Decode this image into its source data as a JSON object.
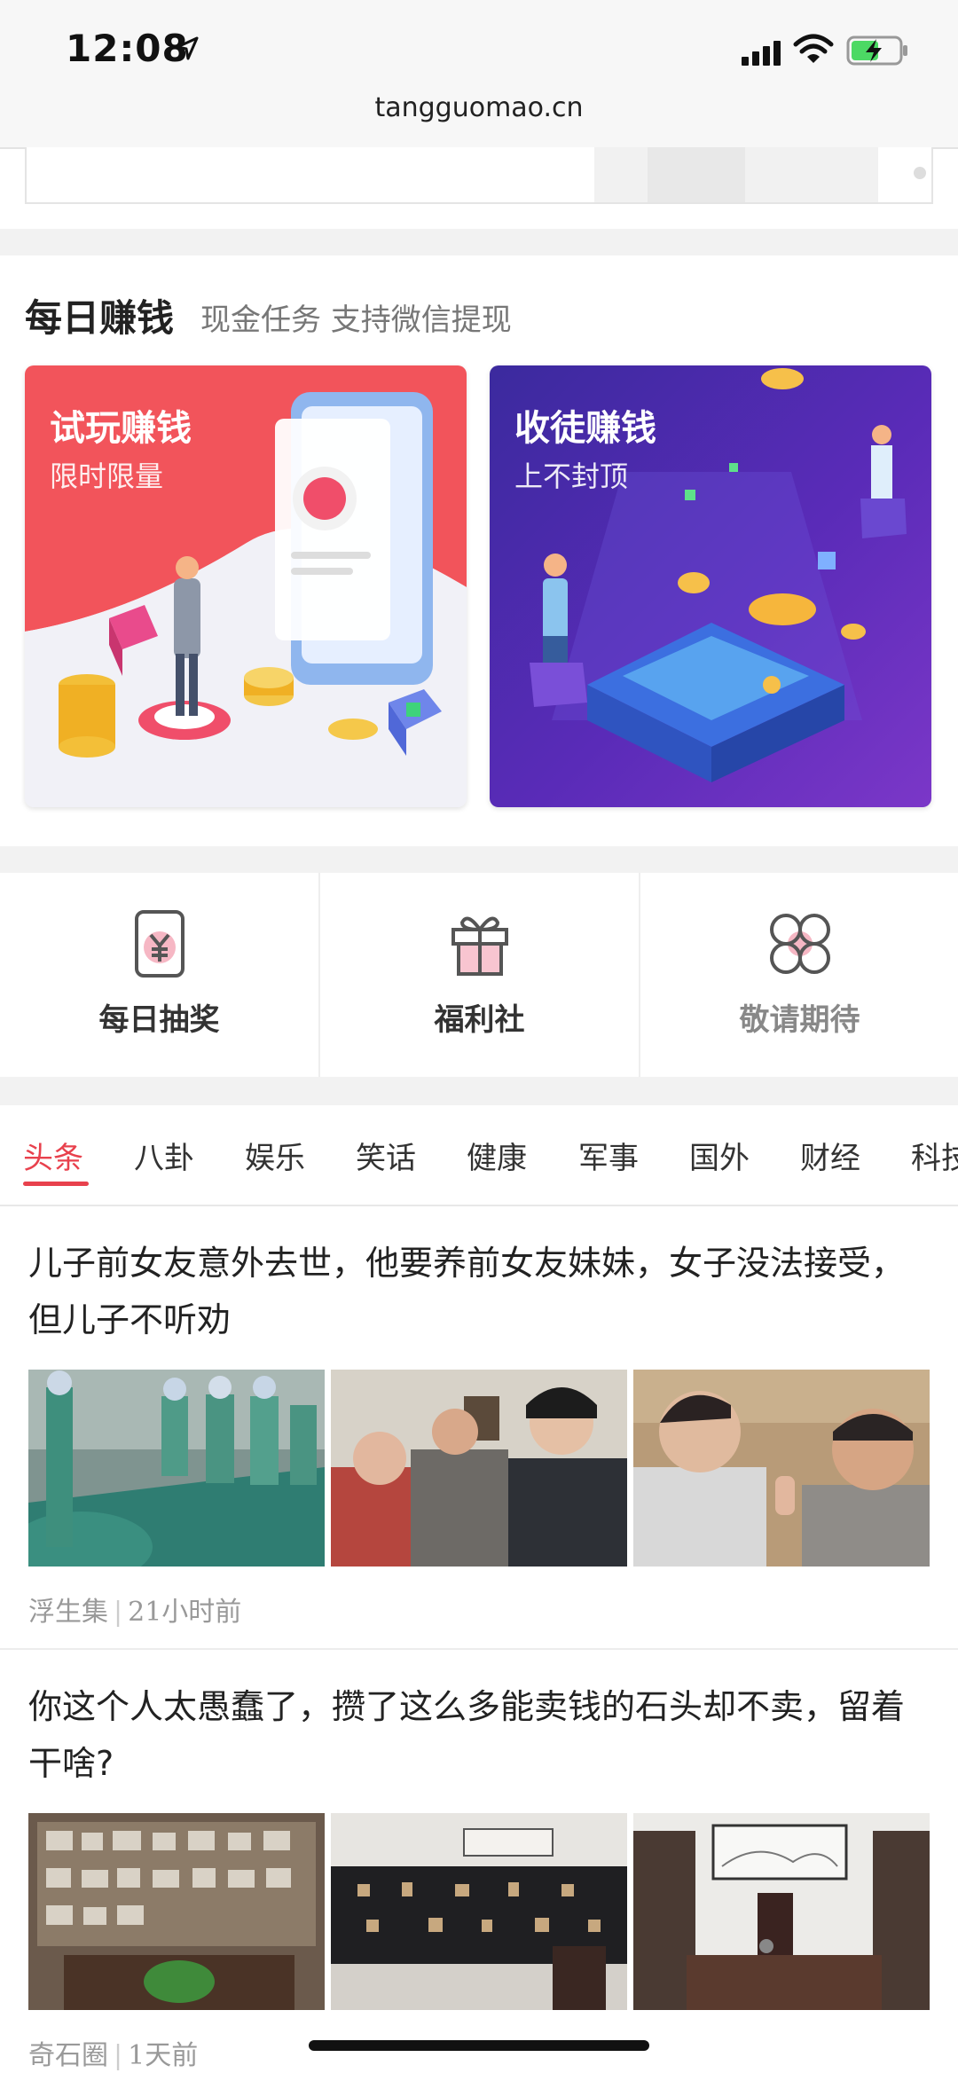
{
  "status_bar": {
    "time": "12:08"
  },
  "browser": {
    "url": "tangguomao.cn"
  },
  "daily_earn": {
    "title": "每日赚钱",
    "subtitle": "现金任务 支持微信提现",
    "cards": [
      {
        "title": "试玩赚钱",
        "subtitle": "限时限量"
      },
      {
        "title": "收徒赚钱",
        "subtitle": "上不封顶"
      }
    ]
  },
  "features": [
    {
      "label": "每日抽奖",
      "icon": "lottery-icon"
    },
    {
      "label": "福利社",
      "icon": "gift-icon"
    },
    {
      "label": "敬请期待",
      "icon": "clover-icon"
    }
  ],
  "tabs": [
    "头条",
    "八卦",
    "娱乐",
    "笑话",
    "健康",
    "军事",
    "国外",
    "财经",
    "科技"
  ],
  "active_tab": "头条",
  "articles": [
    {
      "title": "儿子前女友意外去世，他要养前女友妹妹，女子没法接受，但儿子不听劝",
      "source": "浮生集",
      "time": "21小时前"
    },
    {
      "title": "你这个人太愚蠢了，攒了这么多能卖钱的石头却不卖，留着干啥?",
      "source": "奇石圈",
      "time": "1天前"
    }
  ],
  "colors": {
    "accent": "#e8414d",
    "card_left": "#f2545b",
    "card_right": "#4a2bb0"
  }
}
